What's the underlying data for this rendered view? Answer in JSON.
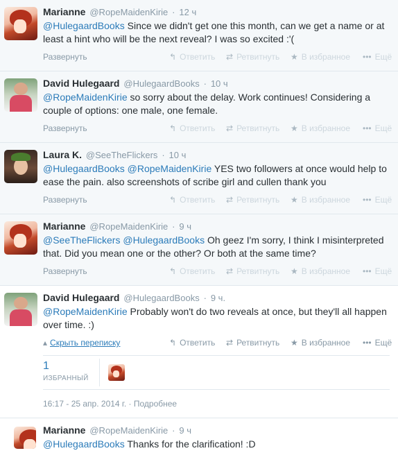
{
  "tweets": [
    {
      "fullname": "Marianne",
      "username": "@RopeMaidenKirie",
      "time": "12 ч",
      "parts": [
        {
          "text": "@HulegaardBooks",
          "mention": true
        },
        {
          "text": " Since we didn't get one this month, can we get a name or at least a hint who will be the next reveal? I was so excited :'(",
          "mention": false
        }
      ],
      "expand": "Развернуть"
    },
    {
      "fullname": "David Hulegaard",
      "username": "@HulegaardBooks",
      "time": "10 ч",
      "parts": [
        {
          "text": "@RopeMaidenKirie",
          "mention": true
        },
        {
          "text": " so sorry about the delay. Work continues! Considering a couple of options: one male, one female.",
          "mention": false
        }
      ],
      "expand": "Развернуть"
    },
    {
      "fullname": "Laura K.",
      "username": "@SeeTheFlickers",
      "time": "10 ч",
      "parts": [
        {
          "text": "@HulegaardBooks",
          "mention": true
        },
        {
          "text": " ",
          "mention": false
        },
        {
          "text": "@RopeMaidenKirie",
          "mention": true
        },
        {
          "text": " YES two followers at once would help to ease the pain. also screenshots of scribe girl and cullen thank you",
          "mention": false
        }
      ],
      "expand": "Развернуть"
    },
    {
      "fullname": "Marianne",
      "username": "@RopeMaidenKirie",
      "time": "9 ч",
      "parts": [
        {
          "text": "@SeeTheFlickers",
          "mention": true
        },
        {
          "text": " ",
          "mention": false
        },
        {
          "text": "@HulegaardBooks",
          "mention": true
        },
        {
          "text": " Oh geez I'm sorry, I think I misinterpreted that. Did you mean one or the other? Or both at the same time?",
          "mention": false
        }
      ],
      "expand": "Развернуть"
    }
  ],
  "focus_tweet": {
    "fullname": "David Hulegaard",
    "username": "@HulegaardBooks",
    "time": "9 ч.",
    "parts": [
      {
        "text": "@RopeMaidenKirie",
        "mention": true
      },
      {
        "text": " Probably won't do two reveals at once, but they'll all happen over time. :)",
        "mention": false
      }
    ],
    "hide_conversation": "Скрыть переписку",
    "favorites_count": "1",
    "favorites_label": "ИЗБРАННЫЙ",
    "timestamp": "16:17 - 25 апр. 2014 г.",
    "details": "Подробнее"
  },
  "last_tweet": {
    "fullname": "Marianne",
    "username": "@RopeMaidenKirie",
    "time": "9 ч",
    "parts": [
      {
        "text": "@HulegaardBooks",
        "mention": true
      },
      {
        "text": " Thanks for the clarification! :D",
        "mention": false
      }
    ]
  },
  "actions": {
    "reply": "Ответить",
    "retweet": "Ретвитнуть",
    "favorite": "В избранное",
    "more": "Ещё"
  },
  "icons": {
    "reply": "reply-arrow-icon",
    "retweet": "retweet-icon",
    "favorite": "star-icon",
    "more": "ellipsis-icon",
    "hide": "chevron-up-icon"
  },
  "colors": {
    "link": "#2b7bb9",
    "muted": "#8899a6",
    "text": "#292f33"
  },
  "sep": "·"
}
